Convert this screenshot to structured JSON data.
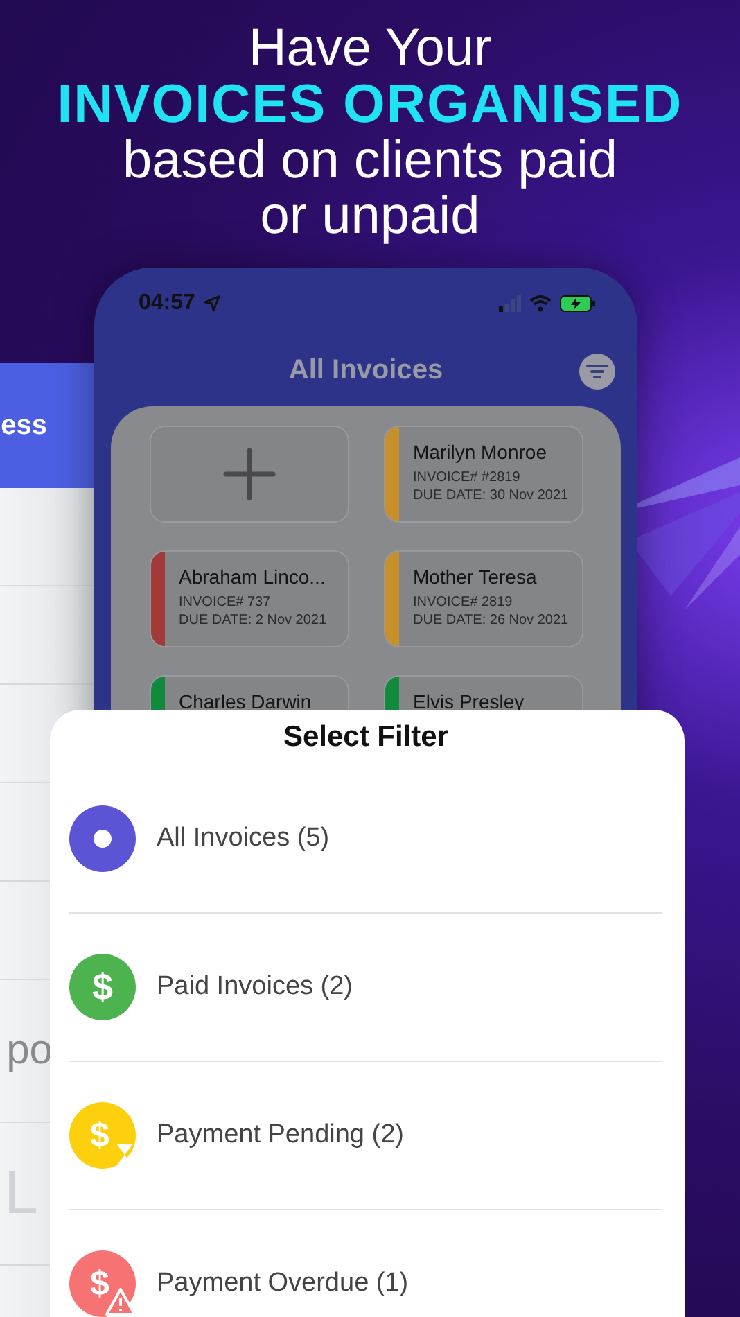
{
  "headline": {
    "line_1": "Have Your",
    "highlight": "INVOICES ORGANISED",
    "line_3": "based on clients paid or unpaid"
  },
  "back_screen": {
    "header_text": "ess",
    "row_text": "po",
    "faint_text": "L"
  },
  "phone": {
    "status_bar": {
      "time": "04:57"
    },
    "title": "All Invoices",
    "cards": [
      {
        "kind": "add"
      },
      {
        "kind": "invoice",
        "name": "Marilyn Monroe",
        "invoice": "INVOICE# #2819",
        "due_date": "DUE DATE: 30 Nov 2021",
        "color": "#c8902a"
      },
      {
        "kind": "invoice",
        "name": "Abraham Linco...",
        "invoice": "INVOICE# 737",
        "due_date": "DUE DATE: 2 Nov 2021",
        "color": "#a33a3a"
      },
      {
        "kind": "invoice",
        "name": "Mother Teresa",
        "invoice": "INVOICE# 2819",
        "due_date": "DUE DATE: 26 Nov 2021",
        "color": "#c8902a"
      },
      {
        "kind": "invoice",
        "name": "Charles Darwin",
        "color": "#118a3e"
      },
      {
        "kind": "invoice",
        "name": "Elvis Presley",
        "color": "#118a3e"
      }
    ]
  },
  "filter_sheet": {
    "title": "Select Filter",
    "options": [
      {
        "kind": "all",
        "label": "All Invoices (5)",
        "color": "#5b55d6"
      },
      {
        "kind": "paid",
        "symbol": "$",
        "label": "Paid Invoices (2)",
        "color": "#4db34f"
      },
      {
        "kind": "pending",
        "symbol": "$",
        "label": "Payment Pending (2)",
        "color": "#fcd00c"
      },
      {
        "kind": "overdue",
        "symbol": "$",
        "label": "Payment Overdue (1)",
        "color": "#f77272"
      }
    ]
  }
}
